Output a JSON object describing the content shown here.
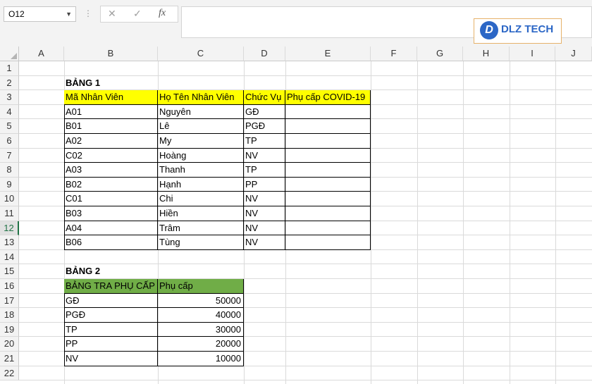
{
  "name_box": "O12",
  "formula_bar": {
    "cancel_icon": "✕",
    "enter_icon": "✓",
    "fx_label": "fx",
    "content": ""
  },
  "logo": {
    "text": "DLZ TECH",
    "mark": "D"
  },
  "columns": [
    "A",
    "B",
    "C",
    "D",
    "E",
    "F",
    "G",
    "H",
    "I",
    "J"
  ],
  "rows": [
    "1",
    "2",
    "3",
    "4",
    "5",
    "6",
    "7",
    "8",
    "9",
    "10",
    "11",
    "12",
    "13",
    "14",
    "15",
    "16",
    "17",
    "18",
    "19",
    "20",
    "21",
    "22"
  ],
  "selected_row": "12",
  "table1": {
    "title": "BẢNG 1",
    "headers": [
      "Mã Nhân Viên",
      "Họ Tên Nhân Viên",
      "Chức Vụ",
      "Phụ cấp COVID-19"
    ],
    "rows": [
      [
        "A01",
        "Nguyên",
        "GĐ",
        ""
      ],
      [
        "B01",
        "Lê",
        "PGĐ",
        ""
      ],
      [
        "A02",
        "My",
        "TP",
        ""
      ],
      [
        "C02",
        "Hoàng",
        "NV",
        ""
      ],
      [
        "A03",
        "Thanh",
        "TP",
        ""
      ],
      [
        "B02",
        "Hạnh",
        "PP",
        ""
      ],
      [
        "C01",
        "Chi",
        "NV",
        ""
      ],
      [
        "B03",
        "Hiền",
        "NV",
        ""
      ],
      [
        "A04",
        "Trâm",
        "NV",
        ""
      ],
      [
        "B06",
        "Tùng",
        "NV",
        ""
      ]
    ]
  },
  "table2": {
    "title": "BẢNG 2",
    "headers": [
      "BẢNG TRA PHỤ CẤP",
      "Phụ cấp"
    ],
    "rows": [
      [
        "GĐ",
        "50000"
      ],
      [
        "PGĐ",
        "40000"
      ],
      [
        "TP",
        "30000"
      ],
      [
        "PP",
        "20000"
      ],
      [
        "NV",
        "10000"
      ]
    ]
  },
  "colors": {
    "header_yellow": "#ffff00",
    "header_green": "#70ad47",
    "selected_accent": "#217346"
  }
}
